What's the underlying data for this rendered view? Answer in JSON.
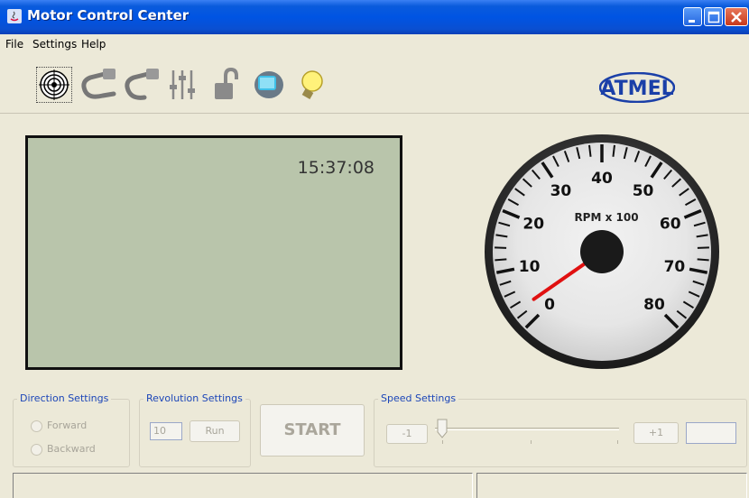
{
  "window": {
    "title": "Motor Control Center",
    "buttons": [
      "minimize-icon",
      "maximize-icon",
      "close-icon"
    ]
  },
  "menu": {
    "items": [
      "File",
      "Settings",
      "Help"
    ]
  },
  "toolbar": {
    "tools": [
      "target-icon",
      "usb-connect-icon",
      "usb-disconnect-icon",
      "sliders-icon",
      "unlock-icon",
      "monitor-icon",
      "lightbulb-icon"
    ],
    "logo": "ATMEL"
  },
  "display": {
    "clock": "15:37:08"
  },
  "gauge": {
    "unit_label": "RPM x 100",
    "scale_labels": [
      "0",
      "10",
      "20",
      "30",
      "40",
      "50",
      "60",
      "70",
      "80"
    ],
    "value": 3
  },
  "direction": {
    "title": "Direction Settings",
    "options": [
      "Forward",
      "Backward"
    ]
  },
  "revolution": {
    "title": "Revolution Settings",
    "value": "10",
    "run_label": "Run"
  },
  "start": {
    "label": "START"
  },
  "speed": {
    "title": "Speed Settings",
    "minus_label": "-1",
    "plus_label": "+1",
    "value": ""
  },
  "colors": {
    "titlebar": "#0054e3",
    "lcd": "#b9c5ab",
    "panel_title": "#1c46b8",
    "needle": "#e01010",
    "background": "#ece9d8"
  }
}
